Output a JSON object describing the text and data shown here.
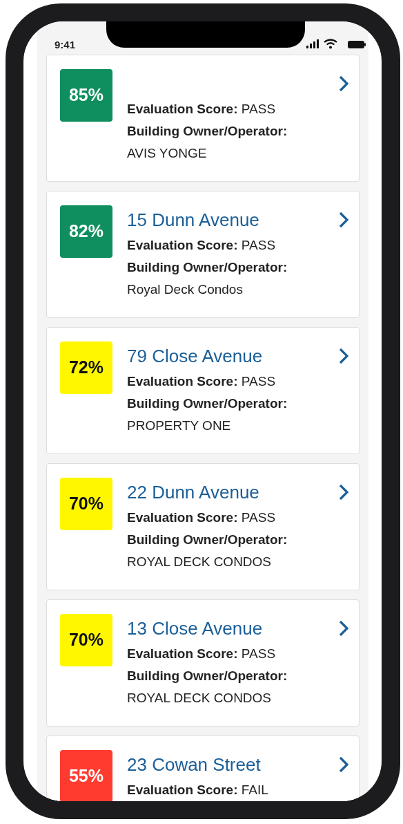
{
  "status_bar": {
    "time": "9:41"
  },
  "buildings": [
    {
      "score": "85%",
      "color": "#0f8f5f",
      "evaluation_label": "Evaluation Score:",
      "evaluation": "PASS",
      "owner_label": "Building Owner/Operator:",
      "owner": "AVIS YONGE"
    },
    {
      "address": "15 Dunn Avenue",
      "score": "82%",
      "color": "#0f8f5f",
      "evaluation_label": "Evaluation Score:",
      "evaluation": "PASS",
      "owner_label": "Building Owner/Operator:",
      "owner": "Royal Deck Condos"
    },
    {
      "address": "79 Close Avenue",
      "score": "72%",
      "color": "#fff700",
      "evaluation_label": "Evaluation Score:",
      "evaluation": "PASS",
      "owner_label": "Building Owner/Operator:",
      "owner": "PROPERTY ONE"
    },
    {
      "address": "22 Dunn Avenue",
      "score": "70%",
      "color": "#fff700",
      "evaluation_label": "Evaluation Score:",
      "evaluation": "PASS",
      "owner_label": "Building Owner/Operator:",
      "owner": "ROYAL DECK CONDOS"
    },
    {
      "address": "13 Close Avenue",
      "score": "70%",
      "color": "#fff700",
      "evaluation_label": "Evaluation Score:",
      "evaluation": "PASS",
      "owner_label": "Building Owner/Operator:",
      "owner": "ROYAL DECK CONDOS"
    },
    {
      "address": "23 Cowan Street",
      "score": "55%",
      "color": "#ff3b30",
      "evaluation_label": "Evaluation Score:",
      "evaluation": "FAIL"
    }
  ]
}
